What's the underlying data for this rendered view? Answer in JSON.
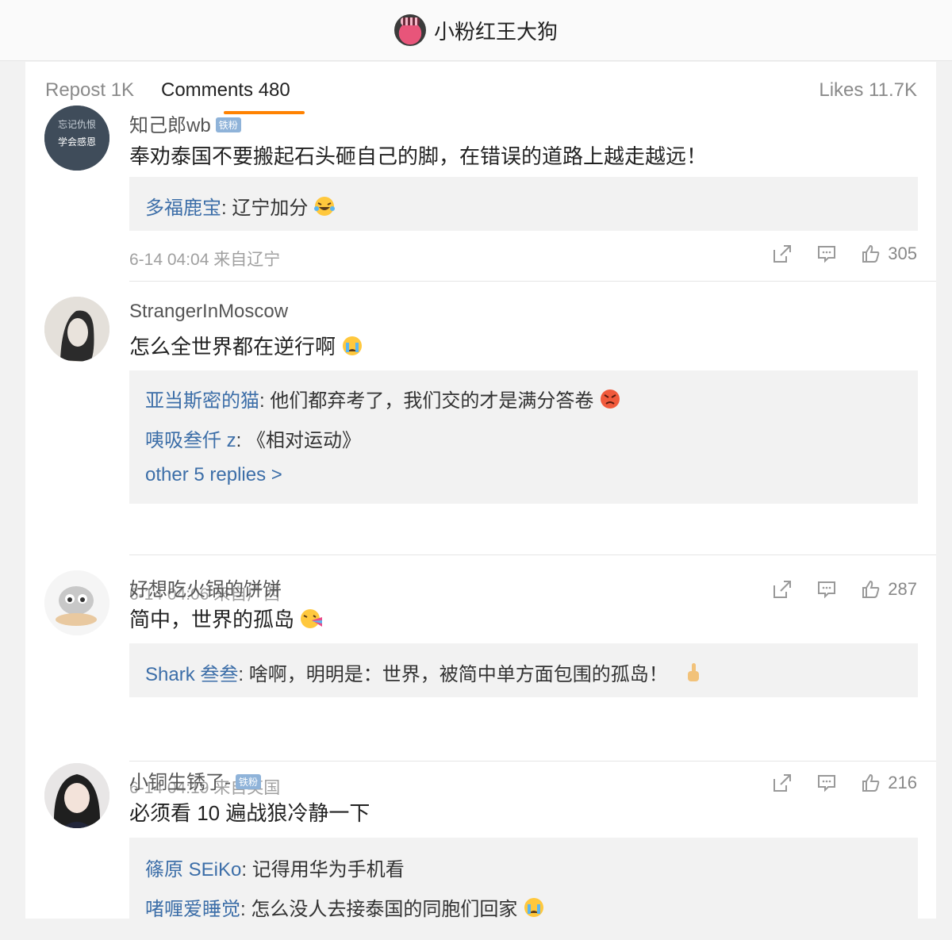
{
  "header": {
    "title": "小粉红王大狗",
    "avatar_icon": "profile-avatar"
  },
  "tabs": {
    "repost": "Repost 1K",
    "comments": "Comments 480",
    "likes": "Likes 11.7K",
    "active": "comments",
    "accent": "#ff8200"
  },
  "comments": [
    {
      "username": "知己郎wb",
      "badge": "铁粉",
      "text": "奉劝泰国不要搬起石头砸自己的脚，在错误的道路上越走越远！",
      "replies": [
        {
          "name": "多福鹿宝",
          "text": ": 辽宁加分"
        }
      ],
      "meta": "6-14 04:04 来自辽宁",
      "likes": "305"
    },
    {
      "username": "StrangerInMoscow",
      "text": "怎么全世界都在逆行啊",
      "replies": [
        {
          "name": "亚当斯密的猫",
          "text": ": 他们都弃考了，我们交的才是满分答卷"
        },
        {
          "name": "咦吸叁仟 z",
          "text": ": 《相对运动》"
        }
      ],
      "more": "other 5 replies >",
      "meta": "6-14 04:06 来自广西",
      "likes": "287"
    },
    {
      "username": "好想吃火锅的饼饼",
      "text": "简中，世界的孤岛",
      "replies": [
        {
          "name": "Shark 叁叁",
          "text": ": 啥啊，明明是：世界，被简中单方面包围的孤岛！"
        }
      ],
      "meta": "6-14 04:19 来自英国",
      "likes": "216"
    },
    {
      "username": "小铜生锈了-",
      "badge": "铁粉",
      "text": "必须看 10 遍战狼冷静一下",
      "replies": [
        {
          "name": "篠原 SEiKo",
          "text": ": 记得用华为手机看"
        },
        {
          "name": "啫喱爱睡觉",
          "text": ": 怎么没人去接泰国的同胞们回家"
        }
      ]
    }
  ],
  "colors": {
    "link": "#3c6ea8",
    "meta": "#a0a0a0",
    "reply_bg": "#f2f2f2"
  }
}
